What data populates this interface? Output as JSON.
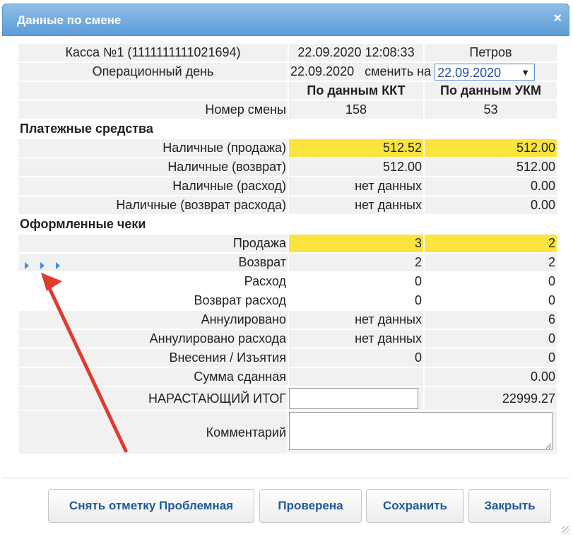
{
  "dialog": {
    "title": "Данные по смене",
    "close_label": "×"
  },
  "info": {
    "kassa": "Касса №1 (1111111111021694)",
    "datetime": "22.09.2020 12:08:33",
    "cashier": "Петров",
    "opday_label": "Операционный день",
    "opday_value": "22.09.2020",
    "change_label": "сменить на",
    "change_value": "22.09.2020"
  },
  "columns": {
    "kkt": "По данным ККТ",
    "ukm": "По данным УКМ"
  },
  "shift": {
    "label": "Номер смены",
    "kkt": "158",
    "ukm": "53"
  },
  "payments": {
    "title": "Платежные средства",
    "rows": [
      {
        "label": "Наличные (продажа)",
        "kkt": "512.52",
        "ukm": "512.00"
      },
      {
        "label": "Наличные (возврат)",
        "kkt": "512.00",
        "ukm": "512.00"
      },
      {
        "label": "Наличные (расход)",
        "kkt": "нет данных",
        "ukm": "0.00"
      },
      {
        "label": "Наличные (возврат расхода)",
        "kkt": "нет данных",
        "ukm": "0.00"
      }
    ]
  },
  "checks": {
    "title": "Оформленные чеки",
    "rows": [
      {
        "label": "Продажа",
        "kkt": "3",
        "ukm": "2"
      },
      {
        "label": "Возврат",
        "kkt": "2",
        "ukm": "2"
      },
      {
        "label": "Расход",
        "kkt": "0",
        "ukm": "0"
      },
      {
        "label": "Возврат расход",
        "kkt": "0",
        "ukm": "0"
      },
      {
        "label": "Аннулировано",
        "kkt": "нет данных",
        "ukm": "6"
      },
      {
        "label": "Аннулировано расхода",
        "kkt": "нет данных",
        "ukm": "0"
      },
      {
        "label": "Внесения / Изъятия",
        "kkt": "0",
        "ukm": "0"
      },
      {
        "label": "Сумма сданная",
        "kkt": "",
        "ukm": "0.00"
      }
    ]
  },
  "total": {
    "label": "НАРАСТАЮЩИЙ ИТОГ",
    "input_value": "",
    "ukm": "22999.27"
  },
  "comment": {
    "label": "Комментарий",
    "value": ""
  },
  "buttons": {
    "unmark": "Снять отметку Проблемная",
    "checked": "Проверена",
    "save": "Сохранить",
    "close": "Закрыть"
  },
  "colors": {
    "title_bar": "#6aa8dc",
    "highlight": "#fbe43d",
    "button_text": "#1e5ba0",
    "arrow": "#e03b2f"
  }
}
